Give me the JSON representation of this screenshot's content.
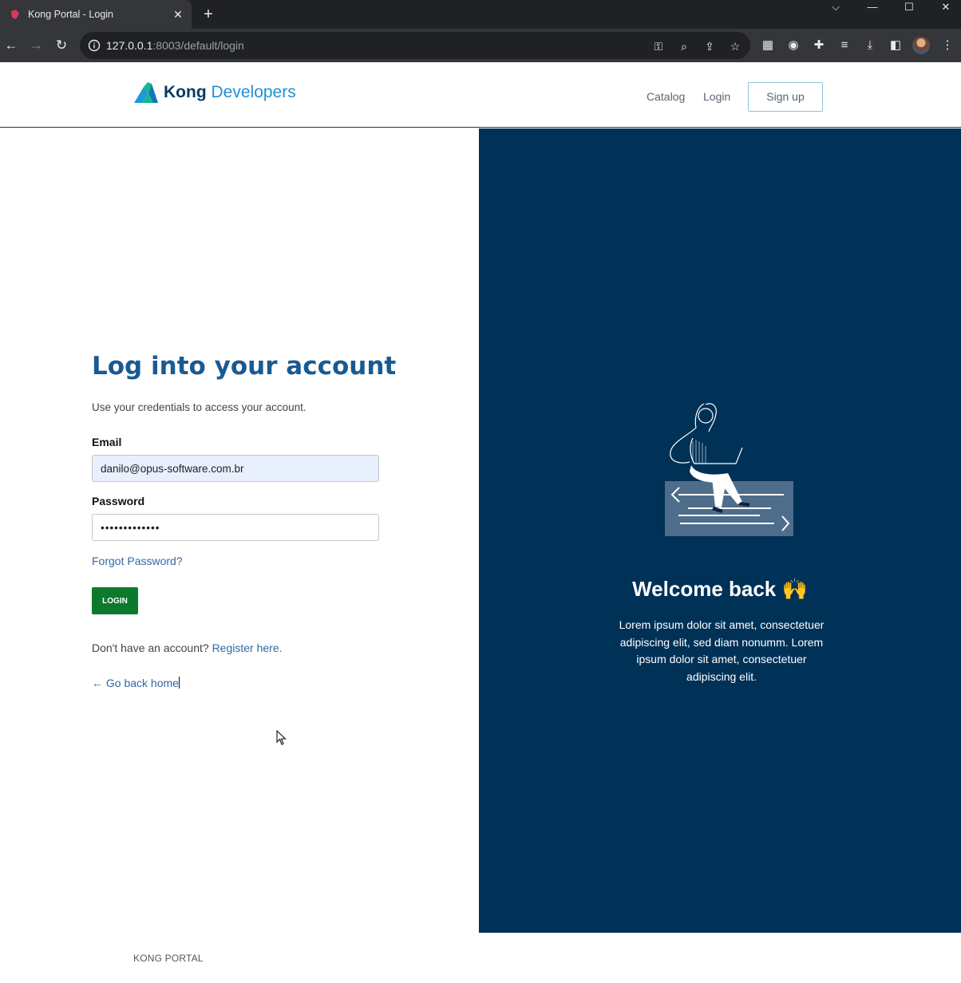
{
  "browser": {
    "tab_title": "Kong Portal - Login",
    "new_tab_label": "+",
    "url_host": "127.0.0.1",
    "url_rest": ":8003/default/login"
  },
  "header": {
    "brand_bold": "Kong",
    "brand_light": "Developers",
    "nav": [
      "Catalog",
      "Login"
    ],
    "signup_label": "Sign up"
  },
  "login": {
    "title": "Log into your account",
    "subtitle": "Use your credentials to access your account.",
    "email_label": "Email",
    "email_value": "danilo@opus-software.com.br",
    "password_label": "Password",
    "password_value": "•••••••••••••",
    "forgot_label": "Forgot Password?",
    "button_label": "LOGIN",
    "register_prompt": "Don't have an account?",
    "register_link": "Register here.",
    "back_home": "← Go back home"
  },
  "welcome": {
    "title": "Welcome back 🙌",
    "text": "Lorem ipsum dolor sit amet, consectetuer adipiscing elit, sed diam nonumm. Lorem ipsum dolor sit amet, consectetuer adipiscing elit."
  },
  "footer": {
    "text": "KONG PORTAL"
  },
  "colors": {
    "panel": "#003157",
    "accent_link": "#2e6aa8",
    "login_button": "#0c7a2c",
    "title": "#1a5a93"
  },
  "icons": [
    "kong-favicon-icon",
    "back-arrow-icon",
    "forward-arrow-icon",
    "reload-icon",
    "info-icon",
    "key-icon",
    "zoom-icon",
    "share-icon",
    "star-icon",
    "qr-icon",
    "extension-icon",
    "puzzle-icon",
    "media-icon",
    "download-icon",
    "sidepanel-icon",
    "menu-icon",
    "kong-logo-icon"
  ]
}
